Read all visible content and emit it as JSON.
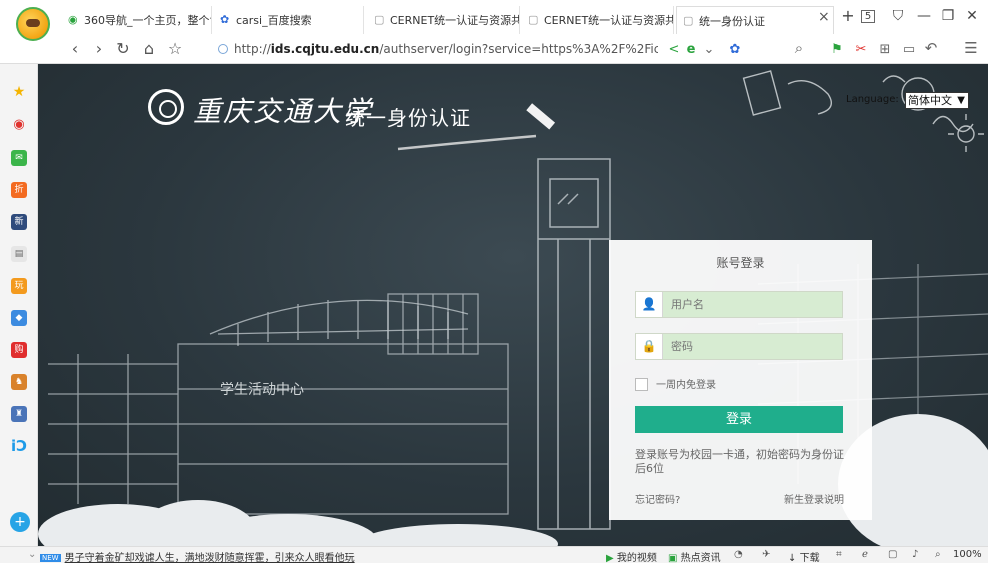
{
  "tabs": [
    {
      "label": "360导航_一个主页，整个世",
      "icon": "360-nav-icon"
    },
    {
      "label": "carsi_百度搜索",
      "icon": "baidu-paw-icon"
    },
    {
      "label": "CERNET统一认证与资源共",
      "icon": "page-icon"
    },
    {
      "label": "CERNET统一认证与资源共",
      "icon": "page-icon"
    },
    {
      "label": "统一身份认证",
      "icon": "page-icon"
    }
  ],
  "tab_close": "×",
  "new_tab": "+",
  "window_controls": {
    "tabs_list": "5",
    "skin": "⛉",
    "minimize": "—",
    "restore": "❐",
    "close": "✕"
  },
  "address": {
    "scheme": "http://",
    "host": "ids.cqjtu.edu.cn",
    "rest": "/authserver/login?service=https%3A%2F%2Fic"
  },
  "nav": {
    "back": "‹",
    "forward": "›",
    "refresh": "↻",
    "home": "⌂",
    "favorite": "☆",
    "search": "⌕",
    "undo": "↶",
    "menu": "☰"
  },
  "header": {
    "university": "重庆交通大学",
    "system": "统一身份认证",
    "language_label": "Language:",
    "language_value": "简体中文"
  },
  "login": {
    "title": "账号登录",
    "username_placeholder": "用户名",
    "password_placeholder": "密码",
    "remember": "一周内免登录",
    "submit": "登录",
    "hint": "登录账号为校园一卡通，初始密码为身份证后6位",
    "forgot": "忘记密码?",
    "new_student": "新生登录说明"
  },
  "scene": {
    "building_label": "学生活动中心"
  },
  "status": {
    "news_badge": "NEW",
    "news": "男子守着金矿却戏谑人生，满地泼财随意挥霍，引来众人眼看他玩",
    "video": "我的视频",
    "hotnews": "热点资讯",
    "download": "下载",
    "zoom": "100%"
  },
  "colors": {
    "accent": "#1fae8c",
    "input_bg": "#d7ecd2",
    "board": "#2b373e"
  }
}
